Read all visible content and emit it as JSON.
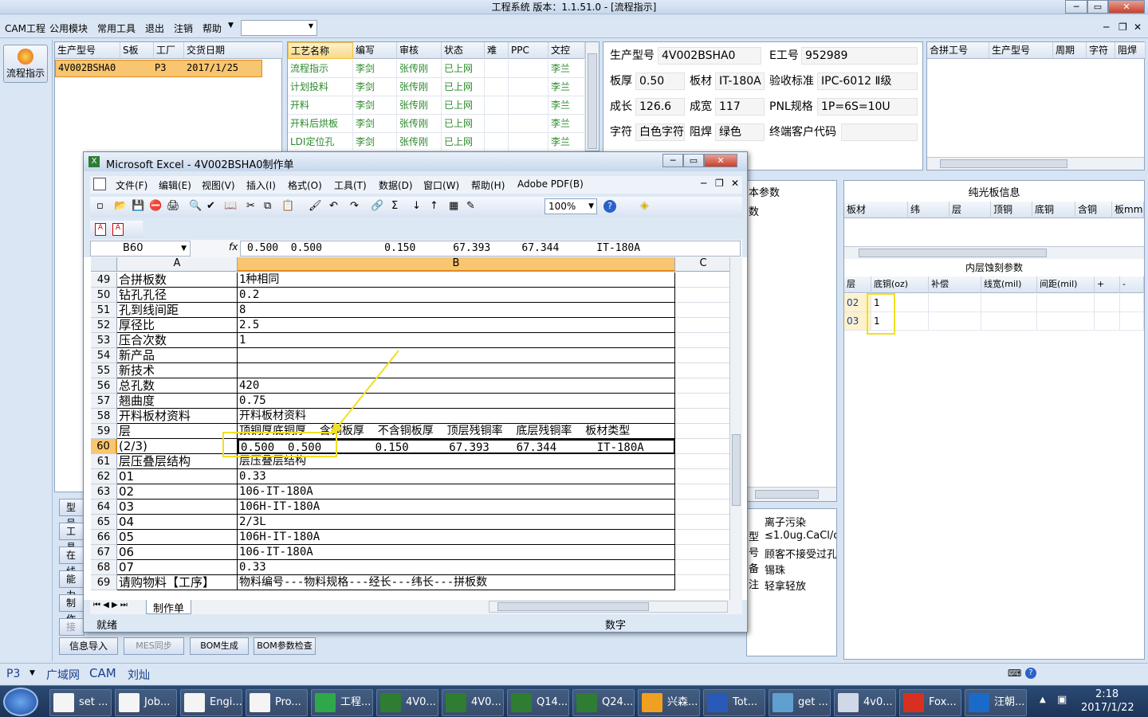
{
  "window": {
    "title": "工程系统   版本：1.1.51.0 - [流程指示]"
  },
  "menu": [
    "CAM工程",
    "公用模块",
    "常用工具",
    "退出",
    "注销",
    "帮助"
  ],
  "sidebar": {
    "button": "流程指示"
  },
  "jobs": {
    "headers": [
      "生产型号",
      "S板",
      "工厂",
      "交货日期"
    ],
    "row": [
      "4V002BSHA0",
      "",
      "P3",
      "2017/1/25"
    ]
  },
  "process": {
    "headers": [
      "工艺名称",
      "编写",
      "审核",
      "状态",
      "难",
      "PPC",
      "文控"
    ],
    "rows": [
      [
        "流程指示",
        "李剑",
        "张传刚",
        "已上网",
        "",
        "",
        "李兰"
      ],
      [
        "计划投料",
        "李剑",
        "张传刚",
        "已上网",
        "",
        "",
        "李兰"
      ],
      [
        "开料",
        "李剑",
        "张传刚",
        "已上网",
        "",
        "",
        "李兰"
      ],
      [
        "开料后烘板",
        "李剑",
        "张传刚",
        "已上网",
        "",
        "",
        "李兰"
      ],
      [
        "LDI定位孔",
        "李剑",
        "张传刚",
        "已上网",
        "",
        "",
        "李兰"
      ]
    ]
  },
  "info": {
    "model_label": "生产型号",
    "model": "4V002BSHA0",
    "eno_label": "E工号",
    "eno": "952989",
    "thick_label": "板厚",
    "thick": "0.50",
    "mat_label": "板材",
    "mat": "IT-180A",
    "std_label": "验收标准",
    "std": "IPC-6012 Ⅱ级",
    "len_label": "成长",
    "len": "126.6",
    "wid_label": "成宽",
    "wid": "117",
    "pnl_label": "PNL规格",
    "pnl": "1P=6S=10U",
    "char_label": "字符",
    "char": "白色字符",
    "mask_label": "阻焊",
    "mask": "绿色",
    "cust_label": "终端客户代码",
    "cust": ""
  },
  "merge": {
    "headers": [
      "合拼工号",
      "生产型号",
      "周期",
      "字符",
      "阻焊"
    ]
  },
  "pure_board": {
    "title": "纯光板信息",
    "headers": [
      "板材",
      "纬",
      "层",
      "顶铜",
      "底铜",
      "含铜",
      "板mm"
    ]
  },
  "inner": {
    "title": "内层蚀刻参数",
    "headers": [
      "层",
      "底铜(oz)",
      "补偿",
      "线宽(mil)",
      "间距(mil)",
      "+",
      "-"
    ],
    "rows": [
      [
        "02",
        "1"
      ],
      [
        "03",
        "1"
      ]
    ]
  },
  "mid_labels": {
    "params": "本参数",
    "nums": "数"
  },
  "notes": {
    "side": [
      "型",
      "号",
      "备",
      "注"
    ],
    "lines": [
      "离子污染",
      "≤1.0ug.CaCl/c",
      "顾客不接受过孔",
      "锡珠",
      "轻拿轻放"
    ]
  },
  "left_tabs": [
    "型号",
    "工具",
    "在线",
    "能力",
    "制作",
    "接外"
  ],
  "bottom_buttons": [
    "信息导入",
    "MES同步",
    "BOM生成",
    "BOM参数检查"
  ],
  "status": {
    "factory": "P3",
    "net": "广域网",
    "app": "CAM",
    "user": "刘灿"
  },
  "excel": {
    "title": "Microsoft Excel - 4V002BSHA0制作单",
    "menu": [
      "文件(F)",
      "编辑(E)",
      "视图(V)",
      "插入(I)",
      "格式(O)",
      "工具(T)",
      "数据(D)",
      "窗口(W)",
      "帮助(H)",
      "Adobe PDF(B)"
    ],
    "zoom": "100%",
    "namebox": "B60",
    "fx": "fx",
    "formula": "0.500  0.500          0.150      67.393     67.344      IT-180A",
    "cols": [
      "A",
      "B",
      "C"
    ],
    "rows": [
      {
        "n": "49",
        "a": "合拼板数",
        "b": "1种相同"
      },
      {
        "n": "50",
        "a": "钻孔孔径",
        "b": "0.2"
      },
      {
        "n": "51",
        "a": "孔到线间距",
        "b": "8"
      },
      {
        "n": "52",
        "a": "厚径比",
        "b": "2.5"
      },
      {
        "n": "53",
        "a": "压合次数",
        "b": "1"
      },
      {
        "n": "54",
        "a": "新产品",
        "b": ""
      },
      {
        "n": "55",
        "a": "新技术",
        "b": ""
      },
      {
        "n": "56",
        "a": "总孔数",
        "b": "420"
      },
      {
        "n": "57",
        "a": "翘曲度",
        "b": "0.75"
      },
      {
        "n": "58",
        "a": "开料板材资料",
        "b": "开料板材资料"
      },
      {
        "n": "59",
        "a": "层",
        "b": "顶铜厚底铜厚  含铜板厚  不含铜板厚  顶层残铜率  底层残铜率  板材类型"
      },
      {
        "n": "60",
        "a": "(2/3)",
        "b": "0.500  0.500        0.150      67.393    67.344      IT-180A"
      },
      {
        "n": "61",
        "a": "层压叠层结构",
        "b": "层压叠层结构"
      },
      {
        "n": "62",
        "a": "01",
        "b": "0.33"
      },
      {
        "n": "63",
        "a": "02",
        "b": "106-IT-180A"
      },
      {
        "n": "64",
        "a": "03",
        "b": "106H-IT-180A"
      },
      {
        "n": "65",
        "a": "04",
        "b": "2/3L"
      },
      {
        "n": "66",
        "a": "05",
        "b": "106H-IT-180A"
      },
      {
        "n": "67",
        "a": "06",
        "b": "106-IT-180A"
      },
      {
        "n": "68",
        "a": "07",
        "b": "0.33"
      },
      {
        "n": "69",
        "a": "请购物料【工序】",
        "b": "物料编号---物料规格---经长---纬长---拼板数"
      }
    ],
    "sheet_tab": "制作单",
    "status_ready": "就绪",
    "status_num": "数字"
  },
  "taskbar": {
    "items": [
      "set ...",
      "Job...",
      "Engi...",
      "Pro...",
      "工程...",
      "4V0...",
      "4V0...",
      "Q14...",
      "Q24...",
      "兴森...",
      "Tot...",
      "get ...",
      "4v0...",
      "Fox...",
      "汪朝..."
    ],
    "time": "2:18",
    "date": "2017/1/22"
  }
}
